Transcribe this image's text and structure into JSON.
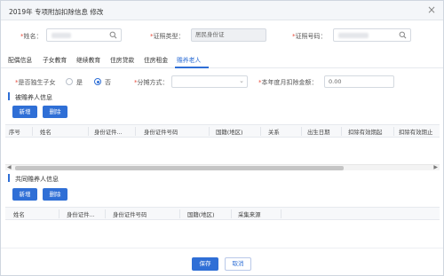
{
  "dialog": {
    "title": "2019年 专项附加扣除信息 修改",
    "close_glyph": "×"
  },
  "form": {
    "name_label": "姓名：",
    "name_value": "",
    "id_type_label": "证照类型：",
    "id_type_value": "居民身份证",
    "id_no_label": "证照号码：",
    "id_no_value": "",
    "required_mark": "*"
  },
  "tabs": [
    {
      "label": "配偶信息"
    },
    {
      "label": "子女教育"
    },
    {
      "label": "继续教育"
    },
    {
      "label": "住房贷款"
    },
    {
      "label": "住房租金"
    },
    {
      "label": "赡养老人"
    }
  ],
  "options": {
    "only_child_label": "是否独生子女",
    "yes_label": "是",
    "no_label": "否",
    "selected": "否",
    "split_label": "分摊方式：",
    "split_value": "",
    "monthly_label": "本年度月扣除金额：",
    "monthly_value": "0.00"
  },
  "section1": {
    "title": "被赡养人信息",
    "add_label": "新增",
    "delete_label": "删除",
    "columns": [
      "序号",
      "姓名",
      "身份证件...",
      "身份证件号码",
      "国籍(地区)",
      "关系",
      "出生日期",
      "扣除有效期起",
      "扣除有效期止"
    ]
  },
  "section2": {
    "title": "共同赡养人信息",
    "add_label": "新增",
    "delete_label": "删除",
    "columns": [
      "姓名",
      "身份证件...",
      "身份证件号码",
      "国籍(地区)",
      "采集来源"
    ]
  },
  "footer": {
    "save_label": "保存",
    "cancel_label": "取消"
  },
  "colors": {
    "accent": "#2f6fd6",
    "required": "#e74c3c"
  },
  "icons": {
    "search": "search-icon",
    "radio": "radio-icon",
    "chevron": "chevron-down-icon"
  }
}
